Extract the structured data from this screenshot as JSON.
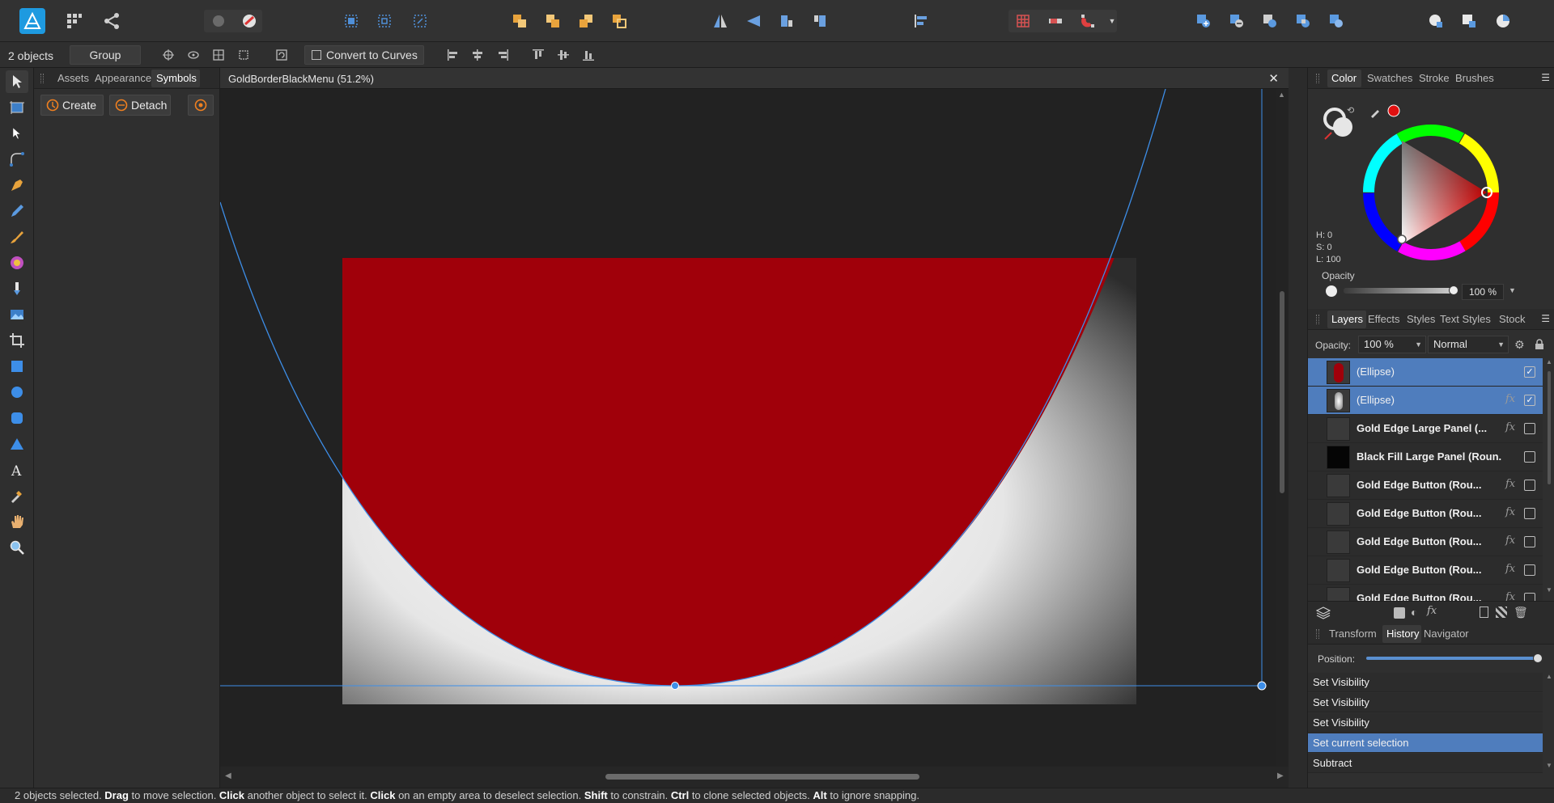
{
  "app": {
    "name": "Affinity Designer"
  },
  "context": {
    "selection_count": "2 objects",
    "group_label": "Group",
    "convert_label": "Convert to Curves"
  },
  "left_studio": {
    "tabs": [
      "Assets",
      "Appearance",
      "Symbols"
    ],
    "active_tab": "Symbols",
    "create_label": "Create",
    "detach_label": "Detach"
  },
  "document": {
    "title": "GoldBorderBlackMenu (51.2%)",
    "close_glyph": "✕"
  },
  "color_panel": {
    "tabs": [
      "Color",
      "Swatches",
      "Stroke",
      "Brushes"
    ],
    "active_tab": "Color",
    "h": "H: 0",
    "s": "S: 0",
    "l": "L: 100",
    "opacity_label": "Opacity",
    "opacity_value": "100 %",
    "opacity_fraction": 1.0,
    "colors": {
      "fill": "#e01010",
      "accent": "#4f7dbd"
    }
  },
  "layers_panel": {
    "tabs": [
      "Layers",
      "Effects",
      "Styles",
      "Text Styles",
      "Stock"
    ],
    "active_tab": "Layers",
    "opacity_label": "Opacity:",
    "opacity_value": "100 %",
    "blend_mode": "Normal",
    "rows": [
      {
        "name": "(Ellipse)",
        "bold": false,
        "selected": true,
        "fx": false,
        "checked": true,
        "thumb": "red-ellipse"
      },
      {
        "name": "(Ellipse)",
        "bold": false,
        "selected": true,
        "fx": true,
        "checked": true,
        "thumb": "white-ellipse"
      },
      {
        "name": "Gold Edge Large Panel (...",
        "bold": true,
        "selected": false,
        "fx": true,
        "checked": false,
        "thumb": "dark"
      },
      {
        "name": "Black Fill Large Panel (Roun...",
        "bold": true,
        "selected": false,
        "fx": false,
        "checked": false,
        "thumb": "black"
      },
      {
        "name": "Gold Edge Button (Rou...",
        "bold": true,
        "selected": false,
        "fx": true,
        "checked": false,
        "thumb": "dark"
      },
      {
        "name": "Gold Edge Button (Rou...",
        "bold": true,
        "selected": false,
        "fx": true,
        "checked": false,
        "thumb": "dark"
      },
      {
        "name": "Gold Edge Button (Rou...",
        "bold": true,
        "selected": false,
        "fx": true,
        "checked": false,
        "thumb": "dark"
      },
      {
        "name": "Gold Edge Button (Rou...",
        "bold": true,
        "selected": false,
        "fx": true,
        "checked": false,
        "thumb": "dark"
      },
      {
        "name": "Gold Edge Button (Rou...",
        "bold": true,
        "selected": false,
        "fx": true,
        "checked": false,
        "thumb": "dark"
      }
    ],
    "fx_glyph": "fx",
    "check_glyph": "✓"
  },
  "history_panel": {
    "tabs": [
      "Transform",
      "History",
      "Navigator"
    ],
    "active_tab": "History",
    "position_label": "Position:",
    "position_fraction": 1.0,
    "rows": [
      {
        "label": "Set Visibility",
        "selected": false
      },
      {
        "label": "Set Visibility",
        "selected": false
      },
      {
        "label": "Set Visibility",
        "selected": false
      },
      {
        "label": "Set current selection",
        "selected": true
      },
      {
        "label": "Subtract",
        "selected": false
      }
    ]
  },
  "status_bar": {
    "parts": [
      {
        "text": "2 objects selected. ",
        "bold": false
      },
      {
        "text": "Drag",
        "bold": true
      },
      {
        "text": " to move selection. ",
        "bold": false
      },
      {
        "text": "Click",
        "bold": true
      },
      {
        "text": " another object to select it. ",
        "bold": false
      },
      {
        "text": "Click",
        "bold": true
      },
      {
        "text": " on an empty area to deselect selection. ",
        "bold": false
      },
      {
        "text": "Shift",
        "bold": true
      },
      {
        "text": " to constrain. ",
        "bold": false
      },
      {
        "text": "Ctrl",
        "bold": true
      },
      {
        "text": " to clone selected objects. ",
        "bold": false
      },
      {
        "text": "Alt",
        "bold": true
      },
      {
        "text": " to ignore snapping.",
        "bold": false
      }
    ]
  }
}
